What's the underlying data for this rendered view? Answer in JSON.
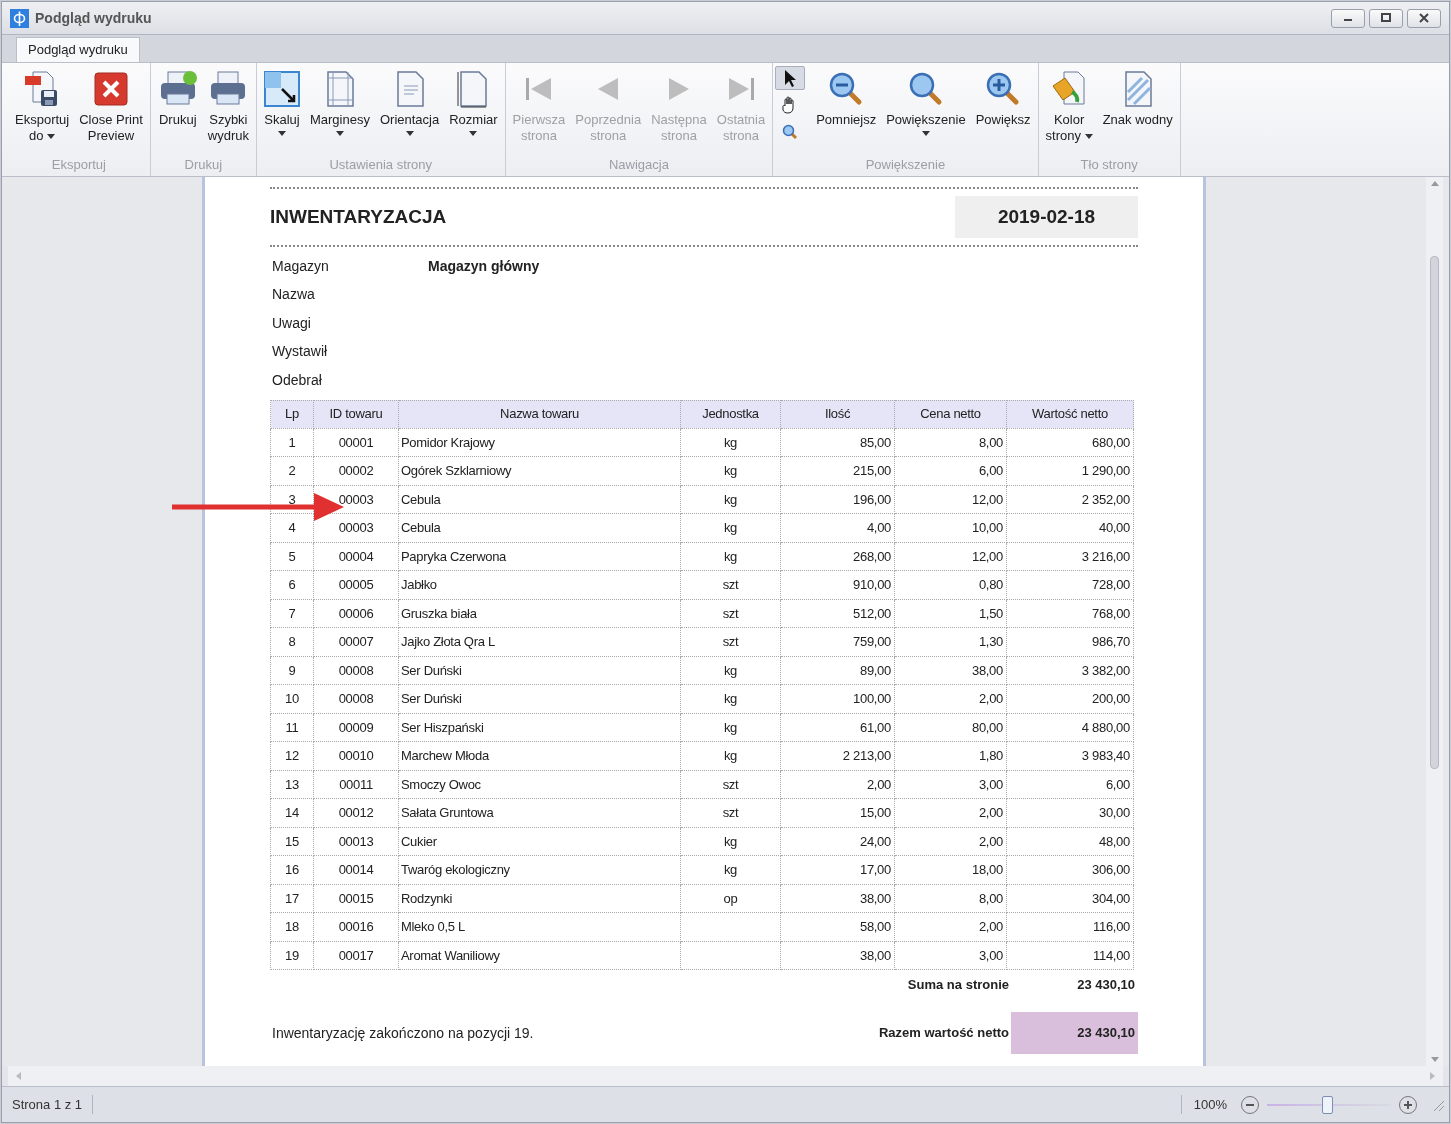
{
  "window": {
    "title": "Podgląd wydruku"
  },
  "tabs": [
    {
      "label": "Podgląd wydruku",
      "selected": true
    }
  ],
  "ribbon": {
    "groups": [
      {
        "label": "Eksportuj",
        "buttons": [
          {
            "label": "Eksportuj\ndo",
            "dropdown": true,
            "disabled": false
          },
          {
            "label": "Close Print\nPreview",
            "dropdown": false,
            "disabled": false
          }
        ]
      },
      {
        "label": "Drukuj",
        "buttons": [
          {
            "label": "Drukuj",
            "dropdown": false,
            "disabled": false
          },
          {
            "label": "Szybki\nwydruk",
            "dropdown": false,
            "disabled": false
          }
        ]
      },
      {
        "label": "Ustawienia strony",
        "buttons": [
          {
            "label": "Skaluj",
            "dropdown": true,
            "disabled": false
          },
          {
            "label": "Marginesy",
            "dropdown": true,
            "disabled": false
          },
          {
            "label": "Orientacja",
            "dropdown": true,
            "disabled": false
          },
          {
            "label": "Rozmiar",
            "dropdown": true,
            "disabled": false
          }
        ]
      },
      {
        "label": "Nawigacja",
        "buttons": [
          {
            "label": "Pierwsza\nstrona",
            "dropdown": false,
            "disabled": true
          },
          {
            "label": "Poprzednia\nstrona",
            "dropdown": false,
            "disabled": true
          },
          {
            "label": "Następna\nstrona",
            "dropdown": false,
            "disabled": true
          },
          {
            "label": "Ostatnia\nstrona",
            "dropdown": false,
            "disabled": true
          }
        ]
      },
      {
        "label": "Powiększenie",
        "tools": [
          {
            "selected": true
          },
          {
            "selected": false
          },
          {
            "selected": false
          }
        ],
        "buttons": [
          {
            "label": "Pomniejsz",
            "dropdown": false,
            "disabled": false
          },
          {
            "label": "Powiększenie",
            "dropdown": true,
            "disabled": false
          },
          {
            "label": "Powiększ",
            "dropdown": false,
            "disabled": false
          }
        ]
      },
      {
        "label": "Tło strony",
        "buttons": [
          {
            "label": "Kolor\nstrony",
            "dropdown": true,
            "disabled": false
          },
          {
            "label": "Znak wodny",
            "dropdown": false,
            "disabled": false
          }
        ]
      }
    ]
  },
  "report": {
    "title": "INWENTARYZACJA",
    "date": "2019-02-18",
    "fields": [
      {
        "label": "Magazyn",
        "value": "Magazyn główny"
      },
      {
        "label": "Nazwa"
      },
      {
        "label": "Uwagi"
      },
      {
        "label": "Wystawił"
      },
      {
        "label": "Odebrał"
      }
    ],
    "columns": [
      "Lp",
      "ID towaru",
      "Nazwa towaru",
      "Jednostka",
      "Ilość",
      "Cena netto",
      "Wartość netto"
    ],
    "rows": [
      [
        "1",
        "00001",
        "Pomidor Krajowy",
        "kg",
        "85,00",
        "8,00",
        "680,00"
      ],
      [
        "2",
        "00002",
        "Ogórek Szklarniowy",
        "kg",
        "215,00",
        "6,00",
        "1 290,00"
      ],
      [
        "3",
        "00003",
        "Cebula",
        "kg",
        "196,00",
        "12,00",
        "2 352,00"
      ],
      [
        "4",
        "00003",
        "Cebula",
        "kg",
        "4,00",
        "10,00",
        "40,00"
      ],
      [
        "5",
        "00004",
        "Papryka Czerwona",
        "kg",
        "268,00",
        "12,00",
        "3 216,00"
      ],
      [
        "6",
        "00005",
        "Jabłko",
        "szt",
        "910,00",
        "0,80",
        "728,00"
      ],
      [
        "7",
        "00006",
        "Gruszka biała",
        "szt",
        "512,00",
        "1,50",
        "768,00"
      ],
      [
        "8",
        "00007",
        "Jajko Złota Qra L",
        "szt",
        "759,00",
        "1,30",
        "986,70"
      ],
      [
        "9",
        "00008",
        "Ser Duński",
        "kg",
        "89,00",
        "38,00",
        "3 382,00"
      ],
      [
        "10",
        "00008",
        "Ser Duński",
        "kg",
        "100,00",
        "2,00",
        "200,00"
      ],
      [
        "11",
        "00009",
        "Ser Hiszpański",
        "kg",
        "61,00",
        "80,00",
        "4 880,00"
      ],
      [
        "12",
        "00010",
        "Marchew Młoda",
        "kg",
        "2 213,00",
        "1,80",
        "3 983,40"
      ],
      [
        "13",
        "00011",
        "Smoczy Owoc",
        "szt",
        "2,00",
        "3,00",
        "6,00"
      ],
      [
        "14",
        "00012",
        "Sałata Gruntowa",
        "szt",
        "15,00",
        "2,00",
        "30,00"
      ],
      [
        "15",
        "00013",
        "Cukier",
        "kg",
        "24,00",
        "2,00",
        "48,00"
      ],
      [
        "16",
        "00014",
        "Twaróg ekologiczny",
        "kg",
        "17,00",
        "18,00",
        "306,00"
      ],
      [
        "17",
        "00015",
        "Rodzynki",
        "op",
        "38,00",
        "8,00",
        "304,00"
      ],
      [
        "18",
        "00016",
        "Mleko 0,5 L",
        "",
        "58,00",
        "2,00",
        "116,00"
      ],
      [
        "19",
        "00017",
        "Aromat Waniliowy",
        "",
        "38,00",
        "3,00",
        "114,00"
      ]
    ],
    "page_sum": {
      "label": "Suma na stronie",
      "value": "23 430,10"
    },
    "note": "Inwentaryzację zakończono na pozycji 19.",
    "total": {
      "label": "Razem wartość netto",
      "value": "23 430,10"
    }
  },
  "status_bar": {
    "page": "Strona 1 z 1",
    "zoom": "100%",
    "zoom_slider": {
      "level": 0.48
    }
  }
}
